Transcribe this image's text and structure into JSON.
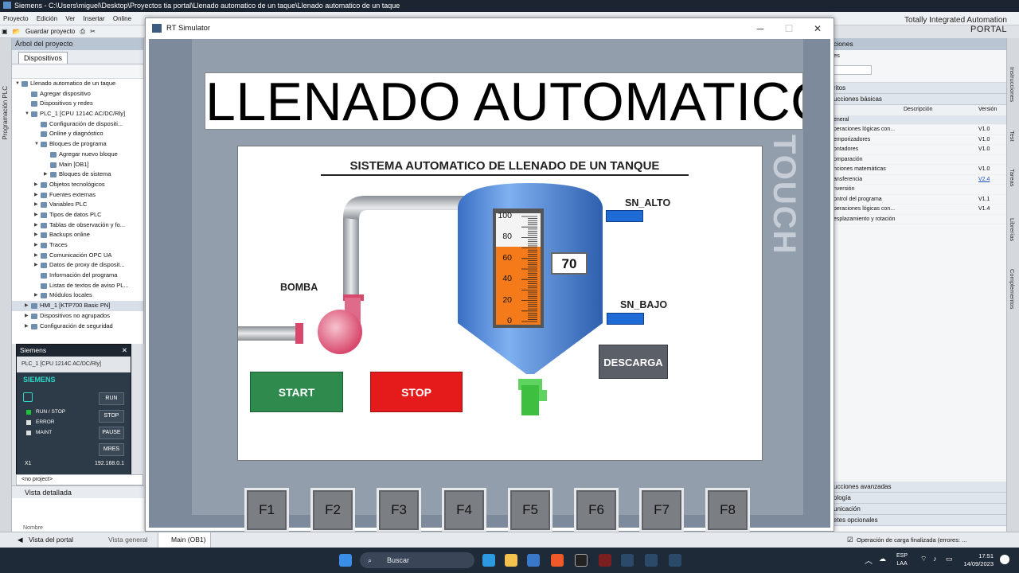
{
  "titlebar": {
    "text": "Siemens  -  C:\\Users\\miguel\\Desktop\\Proyectos tia portal\\Llenado automatico de un taque\\Llenado automatico de un taque"
  },
  "menu": [
    "Proyecto",
    "Edición",
    "Ver",
    "Insertar",
    "Online"
  ],
  "toolbar": {
    "save_label": "Guardar proyecto"
  },
  "brand": {
    "line1": "Totally Integrated Automation",
    "line2": "PORTAL"
  },
  "leftrail": {
    "label": "Programación PLC"
  },
  "tree": {
    "header": "Árbol del proyecto",
    "tab": "Dispositivos",
    "items": [
      {
        "label": "Llenado automatico de un taque",
        "indent": 0,
        "twisty": "▼"
      },
      {
        "label": "Agregar dispositivo",
        "indent": 1,
        "twisty": ""
      },
      {
        "label": "Dispositivos y redes",
        "indent": 1,
        "twisty": ""
      },
      {
        "label": "PLC_1 [CPU 1214C AC/DC/Rly]",
        "indent": 1,
        "twisty": "▼"
      },
      {
        "label": "Configuración de dispositi...",
        "indent": 2,
        "twisty": ""
      },
      {
        "label": "Online y diagnóstico",
        "indent": 2,
        "twisty": ""
      },
      {
        "label": "Bloques de programa",
        "indent": 2,
        "twisty": "▼"
      },
      {
        "label": "Agregar nuevo bloque",
        "indent": 3,
        "twisty": ""
      },
      {
        "label": "Main [OB1]",
        "indent": 3,
        "twisty": ""
      },
      {
        "label": "Bloques de sistema",
        "indent": 3,
        "twisty": "▶"
      },
      {
        "label": "Objetos tecnológicos",
        "indent": 2,
        "twisty": "▶"
      },
      {
        "label": "Fuentes externas",
        "indent": 2,
        "twisty": "▶"
      },
      {
        "label": "Variables PLC",
        "indent": 2,
        "twisty": "▶"
      },
      {
        "label": "Tipos de datos PLC",
        "indent": 2,
        "twisty": "▶"
      },
      {
        "label": "Tablas de observación y fo...",
        "indent": 2,
        "twisty": "▶"
      },
      {
        "label": "Backups online",
        "indent": 2,
        "twisty": "▶"
      },
      {
        "label": "Traces",
        "indent": 2,
        "twisty": "▶"
      },
      {
        "label": "Comunicación OPC UA",
        "indent": 2,
        "twisty": "▶"
      },
      {
        "label": "Datos de proxy de disposit...",
        "indent": 2,
        "twisty": "▶"
      },
      {
        "label": "Información del programa",
        "indent": 2,
        "twisty": ""
      },
      {
        "label": "Listas de textos de aviso PL...",
        "indent": 2,
        "twisty": ""
      },
      {
        "label": "Módulos locales",
        "indent": 2,
        "twisty": "▶"
      },
      {
        "label": "HMI_1 [KTP700 Basic PN]",
        "indent": 1,
        "twisty": "▶"
      },
      {
        "label": "Dispositivos no agrupados",
        "indent": 1,
        "twisty": "▶"
      },
      {
        "label": "Configuración de seguridad",
        "indent": 1,
        "twisty": "▶"
      }
    ]
  },
  "plcsim": {
    "title": "Siemens",
    "device": "PLC_1 [CPU 1214C AC/DC/Rly]",
    "brand": "SIEMENS",
    "leds": [
      "RUN / STOP",
      "ERROR",
      "MAINT"
    ],
    "buttons": [
      "RUN",
      "STOP",
      "PAUSE",
      "MRES"
    ],
    "port": "X1",
    "ip": "192.168.0.1"
  },
  "noproject": "<no project>",
  "detail_view": "Vista detallada",
  "detail_col": "Nombre",
  "rt": {
    "title": "RT Simulator",
    "screen_title": "LLENADO AUTOMATICO",
    "bezel_label": "TOUCH",
    "subtitle": "SISTEMA AUTOMATICO DE LLENADO DE UN TANQUE",
    "labels": {
      "pump": "BOMBA",
      "high": "SN_ALTO",
      "low": "SN_BAJO"
    },
    "level_value": "70",
    "level_fraction": 0.7,
    "scale": [
      "100",
      "80",
      "60",
      "40",
      "20",
      "0"
    ],
    "buttons": {
      "start": "START",
      "stop": "STOP",
      "discharge": "DESCARGA"
    },
    "fkeys": [
      "F1",
      "F2",
      "F3",
      "F4",
      "F5",
      "F6",
      "F7",
      "F8"
    ],
    "colors": {
      "start": "#2e8b4d",
      "stop": "#e51b1b",
      "indicator": "#1f6bd6",
      "fill": "#f47a1a",
      "tank": "#4f86d8"
    }
  },
  "right": {
    "header": "ciones",
    "sub1": "es",
    "sec_favs": "ritos",
    "sec_basic": "ucciones básicas",
    "cols": {
      "desc": "Descripción",
      "ver": "Versión"
    },
    "rows": [
      {
        "name": "eneral",
        "ver": ""
      },
      {
        "name": "peraciones lógicas con...",
        "ver": "V1.0"
      },
      {
        "name": "emporizadores",
        "ver": "V1.0"
      },
      {
        "name": "ontadores",
        "ver": "V1.0"
      },
      {
        "name": "omparación",
        "ver": ""
      },
      {
        "name": "nciones matemáticas",
        "ver": "V1.0"
      },
      {
        "name": "ansferencia",
        "ver": "V2.4"
      },
      {
        "name": "nversión",
        "ver": ""
      },
      {
        "name": "ontrol del programa",
        "ver": "V1.1"
      },
      {
        "name": "peraciones lógicas con...",
        "ver": "V1.4"
      },
      {
        "name": "esplazamiento y rotación",
        "ver": ""
      }
    ],
    "bottom": [
      "ucciones avanzadas",
      "ología",
      "unicación",
      "etes opcionales"
    ],
    "rail": [
      "Instrucciones",
      "Test",
      "Tareas",
      "Librerías",
      "Complementos"
    ]
  },
  "portal_bar": {
    "portal_view": "Vista del portal",
    "overview": "Vista general",
    "main": "Main (OB1)",
    "status": "Operación de carga finalizada (errores: ..."
  },
  "taskbar": {
    "search": "Buscar",
    "lang": "ESP",
    "lang2": "LAA",
    "time": "17:51",
    "date": "14/09/2023"
  }
}
